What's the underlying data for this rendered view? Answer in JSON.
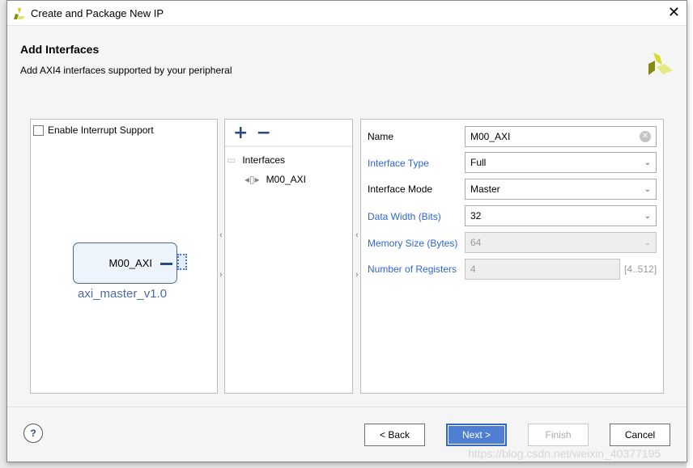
{
  "window": {
    "title": "Create and Package New IP",
    "close_icon": "close-icon"
  },
  "header": {
    "title": "Add Interfaces",
    "subtitle": "Add AXI4 interfaces supported by your peripheral"
  },
  "left_panel": {
    "enable_interrupt_label": "Enable Interrupt Support",
    "enable_interrupt_checked": false,
    "block_port": "M00_AXI",
    "block_name": "axi_master_v1.0"
  },
  "middle_panel": {
    "add_label": "+",
    "remove_label": "−",
    "tree_root": "Interfaces",
    "tree_items": [
      "M00_AXI"
    ]
  },
  "right_panel": {
    "name": {
      "label": "Name",
      "value": "M00_AXI"
    },
    "interface_type": {
      "label": "Interface Type",
      "value": "Full"
    },
    "interface_mode": {
      "label": "Interface Mode",
      "value": "Master"
    },
    "data_width": {
      "label": "Data Width (Bits)",
      "value": "32"
    },
    "memory_size": {
      "label": "Memory Size (Bytes)",
      "value": "64"
    },
    "num_registers": {
      "label": "Number of Registers",
      "value": "4",
      "range": "[4..512]"
    }
  },
  "footer": {
    "help": "?",
    "back": "< Back",
    "next": "Next >",
    "finish": "Finish",
    "cancel": "Cancel"
  },
  "watermark": "https://blog.csdn.net/weixin_40377195",
  "colors": {
    "accent": "#4f7fd3",
    "link_label": "#2f64d8",
    "block_name": "#4d6ba8"
  }
}
